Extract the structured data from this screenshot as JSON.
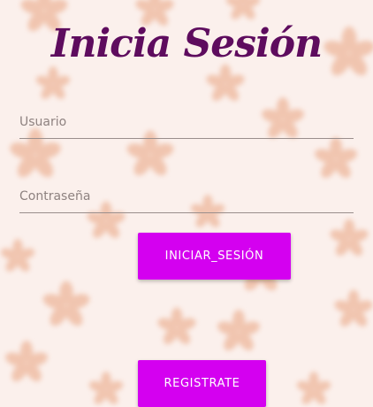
{
  "title": "Inicia Sesión",
  "username": {
    "placeholder": "Usuario",
    "value": ""
  },
  "password": {
    "placeholder": "Contraseña",
    "value": ""
  },
  "login_button": "INICIAR_SESIÓN",
  "register_button": "REGISTRATE",
  "colors": {
    "title": "#5e0c5e",
    "button": "#d400f0",
    "background": "#fbf0ec",
    "flower": "#e8a27e"
  }
}
